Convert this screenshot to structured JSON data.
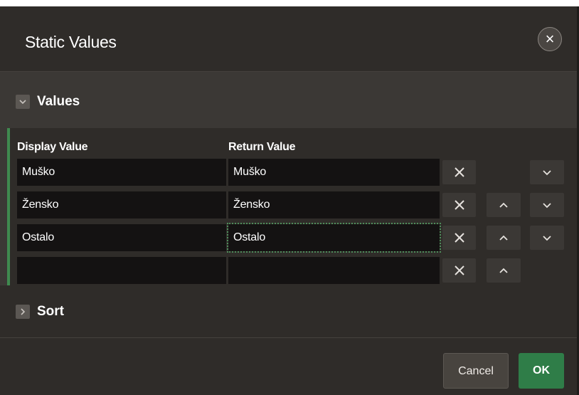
{
  "dialog": {
    "title": "Static Values",
    "close_symbol": "×"
  },
  "values_region": {
    "label": "Values",
    "collapsed": false,
    "columns": {
      "display": "Display Value",
      "return": "Return Value"
    },
    "rows": [
      {
        "display": "Muško",
        "return": "Muško",
        "can_move_up": false,
        "can_move_down": true
      },
      {
        "display": "Žensko",
        "return": "Žensko",
        "can_move_up": true,
        "can_move_down": true
      },
      {
        "display": "Ostalo",
        "return": "Ostalo",
        "can_move_up": true,
        "can_move_down": true
      },
      {
        "display": "",
        "return": "",
        "can_move_up": true,
        "can_move_down": false
      }
    ],
    "focused_cell": "row3-return"
  },
  "sort_region": {
    "label": "Sort",
    "collapsed": true
  },
  "footer": {
    "cancel_label": "Cancel",
    "ok_label": "OK"
  },
  "icons": {
    "close": "close-icon",
    "remove": "remove-row-icon",
    "up": "chevron-up-icon",
    "down": "chevron-down-icon",
    "expanded": "chevron-down-icon",
    "collapsed": "chevron-right-icon"
  },
  "colors": {
    "dialog_bg": "#2f2c29",
    "region_bg": "#3b3835",
    "cell_bg": "#141212",
    "accent_green": "#2f7d48",
    "focus_outline": "#4e8c5a"
  }
}
